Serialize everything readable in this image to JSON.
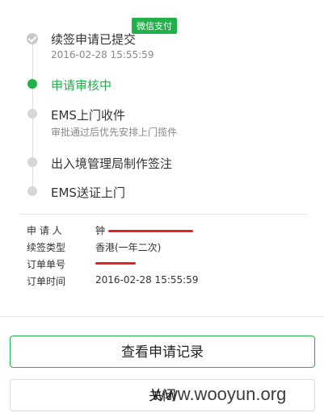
{
  "steps": [
    {
      "title": "续签申请已提交",
      "time": "2016-02-28 15:55:59",
      "status": "done"
    },
    {
      "title": "申请审核中",
      "status": "active"
    },
    {
      "title": "EMS上门收件",
      "subtitle": "审批通过后优先安排上门揽件",
      "status": "pending"
    },
    {
      "title": "出入境管理局制作签注",
      "status": "pending"
    },
    {
      "title": "EMS送证上门",
      "status": "pending"
    }
  ],
  "badge": "微信支付",
  "info": {
    "applicant_label": "申 请 人",
    "applicant_value": "钟",
    "renew_type_label": "续签类型",
    "renew_type_value": "香港(一年二次)",
    "order_no_label": "订单单号",
    "order_no_value": "",
    "order_time_label": "订单时间",
    "order_time_value": "2016-02-28 15:55:59"
  },
  "buttons": {
    "view_records": "查看申请记录",
    "close": "关闭"
  },
  "watermark": "www.wooyun.org",
  "colors": {
    "accent": "#21b14a",
    "redaction": "#e82020"
  }
}
